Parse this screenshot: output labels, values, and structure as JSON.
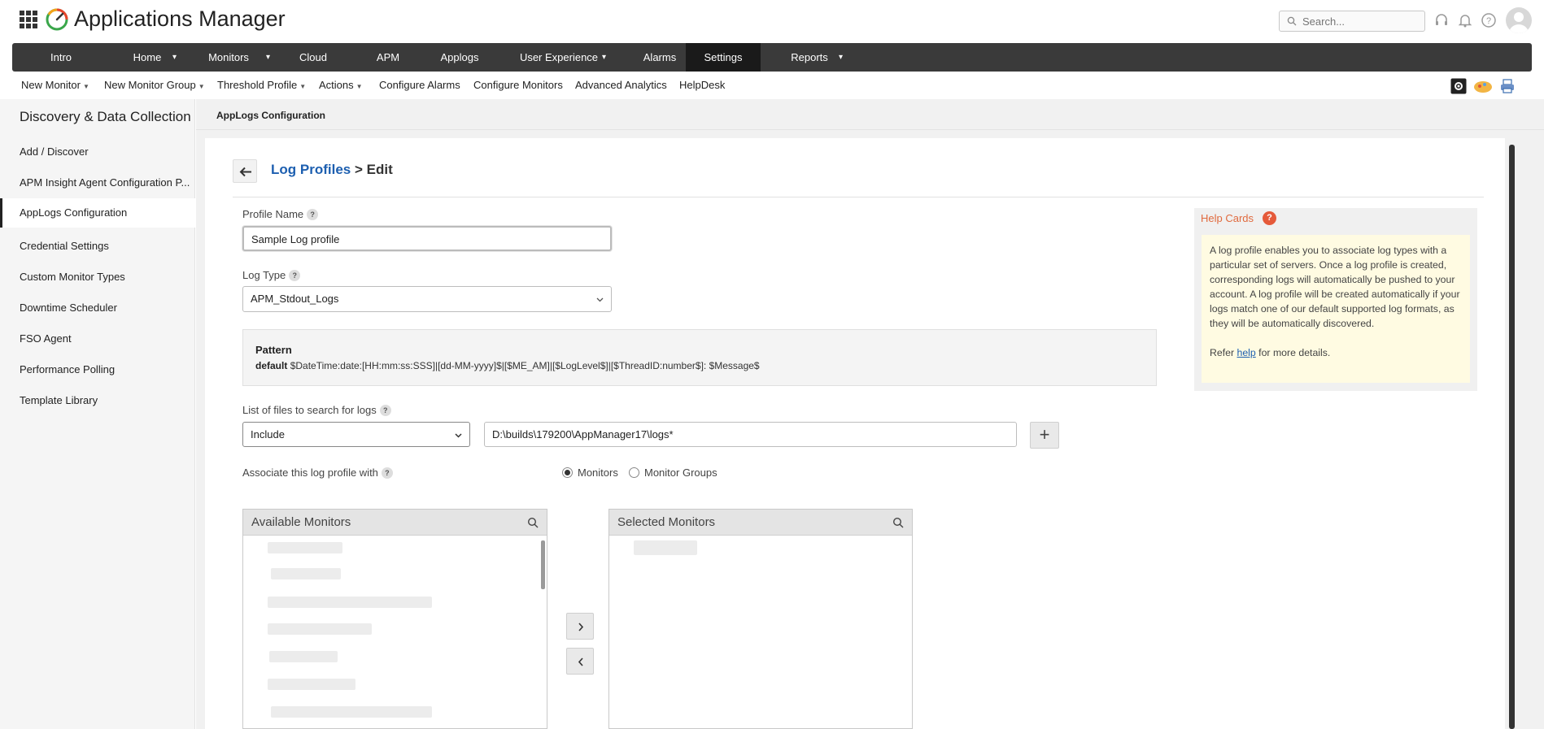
{
  "app": {
    "title": "Applications Manager"
  },
  "search": {
    "placeholder": "Search..."
  },
  "main_nav": [
    "Intro",
    "Home",
    "Monitors",
    "Cloud",
    "APM",
    "Applogs",
    "User Experience",
    "Alarms",
    "Settings",
    "Reports"
  ],
  "main_nav_active": "Settings",
  "sub_nav": [
    "New Monitor",
    "New Monitor Group",
    "Threshold Profile",
    "Actions",
    "Configure Alarms",
    "Configure Monitors",
    "Advanced Analytics",
    "HelpDesk"
  ],
  "sidebar": {
    "title": "Discovery & Data Collection",
    "items": [
      "Add / Discover",
      "APM Insight Agent Configuration P...",
      "AppLogs Configuration",
      "Credential Settings",
      "Custom Monitor Types",
      "Downtime Scheduler",
      "FSO Agent",
      "Performance Polling",
      "Template Library"
    ],
    "active": "AppLogs Configuration"
  },
  "content": {
    "header": "AppLogs Configuration",
    "breadcrumb_link": "Log Profiles",
    "breadcrumb_current": "> Edit"
  },
  "form": {
    "profile_name_label": "Profile Name",
    "profile_name_value": "Sample Log profile",
    "log_type_label": "Log Type",
    "log_type_value": "APM_Stdout_Logs",
    "pattern_title": "Pattern",
    "pattern_default_label": "default",
    "pattern_value": "$DateTime:date:[HH:mm:ss:SSS]|[dd-MM-yyyy]$|[$ME_AM]|[$LogLevel$]|[$ThreadID:number$]: $Message$",
    "files_label": "List of files to search for logs",
    "files_mode": "Include",
    "files_path": "D:\\builds\\179200\\AppManager17\\logs*",
    "associate_label": "Associate this log profile with",
    "radio_monitors": "Monitors",
    "radio_monitor_groups": "Monitor Groups",
    "radio_selected": "Monitors",
    "available_title": "Available Monitors",
    "selected_title": "Selected Monitors"
  },
  "help": {
    "title": "Help Cards",
    "body": "A log profile enables you to associate log types with a particular set of servers. Once a log profile is created, corresponding logs will automatically be pushed to your account. A log profile will be created automatically if your logs match one of our default supported log formats, as they will be automatically discovered.",
    "refer_prefix": "Refer",
    "refer_link": "help",
    "refer_suffix": "for more details."
  },
  "colors": {
    "nav_bg": "#3a3a3a",
    "nav_active": "#1a1a1a",
    "link": "#1d5fb0",
    "help_title": "#e06a3e",
    "help_bg": "#fffbe2"
  },
  "icons": [
    "apps-grid-icon",
    "gauge-logo-icon",
    "search-icon",
    "headset-icon",
    "bell-icon",
    "help-icon",
    "user-avatar-icon",
    "back-arrow-icon",
    "chevron-down-icon",
    "plus-icon",
    "chevron-right-icon",
    "chevron-left-icon"
  ]
}
